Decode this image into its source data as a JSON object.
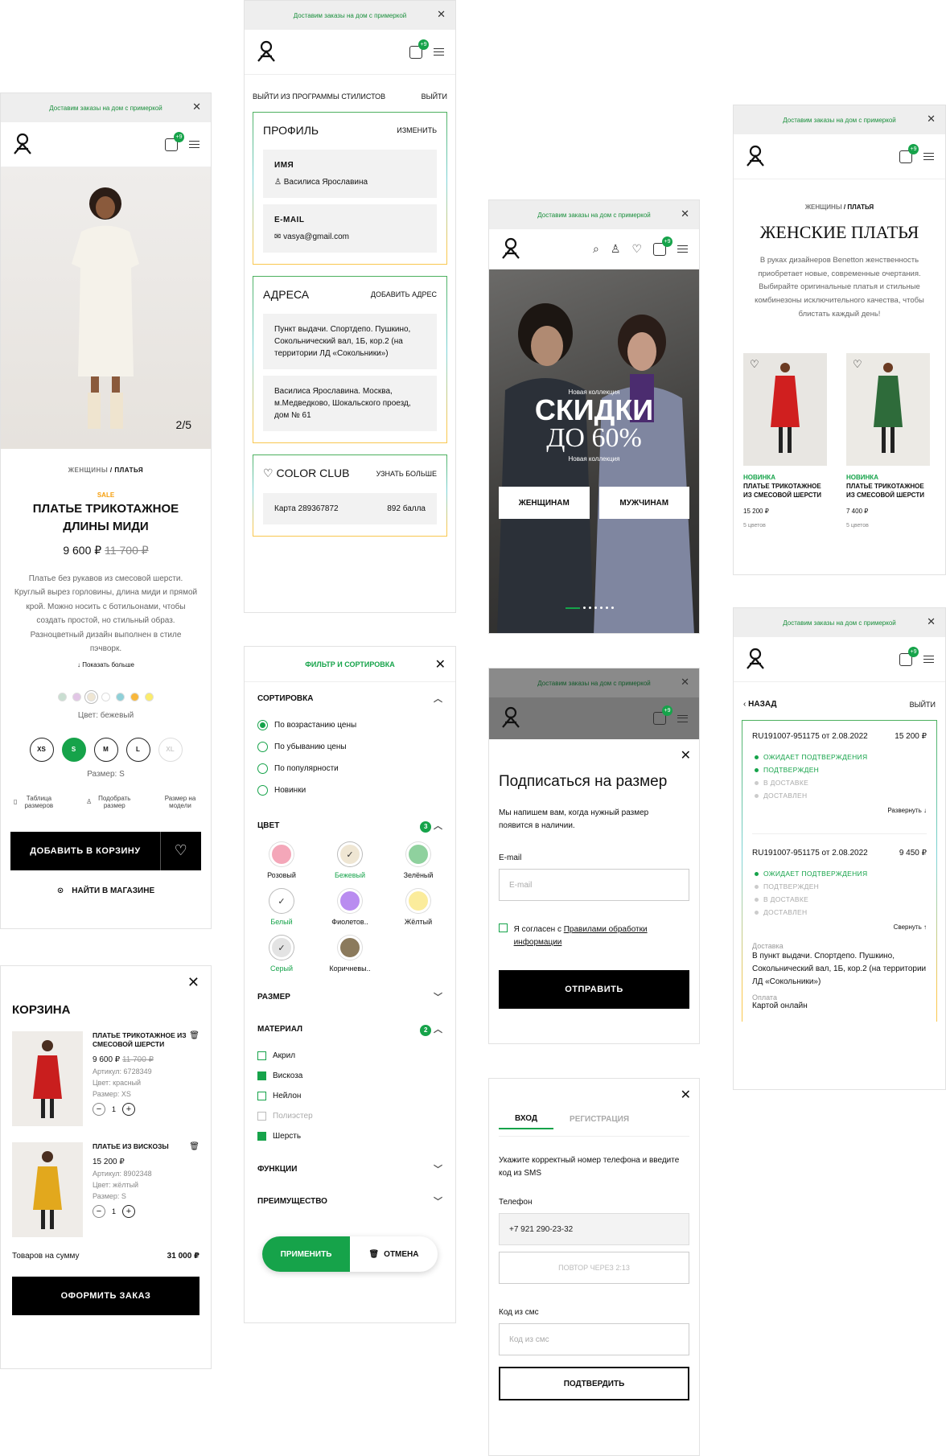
{
  "banner": "Доставим заказы на дом с примеркой",
  "cart_badge": "+9",
  "brand_green": "#16a34a",
  "product": {
    "photo_counter": "2/5",
    "breadcrumb_women": "ЖЕНЩИНЫ",
    "breadcrumb_sep": "/",
    "breadcrumb_dresses": "ПЛАТЬЯ",
    "sale": "SALE",
    "title": "ПЛАТЬЕ ТРИКОТАЖНОЕ ДЛИНЫ МИДИ",
    "price": "9 600 ₽",
    "old_price": "11 700 ₽",
    "description": "Платье без рукавов из смесовой шерсти. Круглый вырез горловины, длина миди и прямой крой. Можно носить с ботильонами, чтобы создать простой, но стильный образ. Разноцветный дизайн выполнен в стиле пэчворк.",
    "show_more": "Показать больше",
    "color_label": "Цвет: бежевый",
    "sizes": [
      "XS",
      "S",
      "M",
      "L",
      "XL"
    ],
    "size_label": "Размер: S",
    "size_table": "Таблица размеров",
    "pick_size": "Подобрать размер",
    "model_size": "Размер на модели",
    "add_to_cart": "ДОБАВИТЬ В КОРЗИНУ",
    "find_in_store": "НАЙТИ В МАГАЗИНЕ"
  },
  "cart": {
    "title": "КОРЗИНА",
    "items": [
      {
        "name": "ПЛАТЬЕ ТРИКОТАЖНОЕ ИЗ СМЕСОВОЙ ШЕРСТИ",
        "price": "9 600 ₽",
        "old_price": "11 700 ₽",
        "article": "Артикул: 6728349",
        "color": "Цвет: красный",
        "size": "Размер: XS",
        "qty": "1"
      },
      {
        "name": "ПЛАТЬЕ ИЗ ВИСКОЗЫ",
        "price": "15 200 ₽",
        "old_price": "",
        "article": "Артикул: 8902348",
        "color": "Цвет: жёлтый",
        "size": "Размер: S",
        "qty": "1"
      }
    ],
    "total_label": "Товаров на сумму",
    "total": "31 000 ₽",
    "checkout": "ОФОРМИТЬ ЗАКАЗ"
  },
  "profile": {
    "exit_program": "ВЫЙТИ ИЗ ПРОГРАММЫ СТИЛИСТОВ",
    "exit": "ВЫЙТИ",
    "profile_title": "ПРОФИЛЬ",
    "edit": "ИЗМЕНИТЬ",
    "name_label": "ИМЯ",
    "name": "Василиса Ярославина",
    "email_label": "E-MAIL",
    "email": "vasya@gmail.com",
    "addresses_title": "АДРЕСА",
    "add_address": "ДОБАВИТЬ АДРЕС",
    "address1": "Пункт выдачи. Спортдепо. Пушкино, Сокольнический вал, 1Б, кор.2 (на территории ЛД «Сокольники»)",
    "address2": "Василиса Ярославина. Москва, м.Медведково, Шокальского проезд, дом № 61",
    "club_title": "COLOR CLUB",
    "learn_more": "УЗНАТЬ БОЛЬШЕ",
    "card": "Карта 289367872",
    "points": "892 балла"
  },
  "filter": {
    "title": "ФИЛЬТР И СОРТИРОВКА",
    "sorting": "СОРТИРОВКА",
    "sort_options": [
      "По возрастанию цены",
      "По убыванию цены",
      "По популярности",
      "Новинки"
    ],
    "color": "ЦВЕТ",
    "color_count": "3",
    "colors": [
      {
        "name": "Розовый",
        "hex": "#f4a7b9"
      },
      {
        "name": "Бежевый",
        "hex": "#efe6d3"
      },
      {
        "name": "Зелёный",
        "hex": "#8fd19e"
      },
      {
        "name": "Белый",
        "hex": "#ffffff"
      },
      {
        "name": "Фиолетов..",
        "hex": "#b98cf0"
      },
      {
        "name": "Жёлтый",
        "hex": "#fbec9c"
      },
      {
        "name": "Серый",
        "hex": "#e3e3e3"
      },
      {
        "name": "Коричневы..",
        "hex": "#8b7a5c"
      }
    ],
    "size": "РАЗМЕР",
    "material": "МАТЕРИАЛ",
    "material_count": "2",
    "materials": [
      "Акрил",
      "Вискоза",
      "Нейлон",
      "Полиэстер",
      "Шерсть"
    ],
    "functions": "ФУНКЦИИ",
    "advantage": "ПРЕИМУЩЕСТВО",
    "apply": "ПРИМЕНИТЬ",
    "cancel": "ОТМЕНА"
  },
  "home": {
    "new_collection": "Новая коллекция",
    "sale_line1": "СКИДКИ",
    "sale_line2": "ДО 60%",
    "women": "ЖЕНЩИНАМ",
    "men": "МУЖЧИНАМ"
  },
  "subscribe": {
    "title": "Подписаться на размер",
    "text": "Мы напишем вам, когда нужный размер появится в наличии.",
    "email_label": "E-mail",
    "email_placeholder": "E-mail",
    "agree_prefix": "Я согласен с ",
    "agree_link": "Правилами обработки информации",
    "send": "ОТПРАВИТЬ"
  },
  "login": {
    "tab_login": "ВХОД",
    "tab_register": "РЕГИСТРАЦИЯ",
    "text": "Укажите корректный номер телефона и введите код из SMS",
    "phone_label": "Телефон",
    "phone": "+7 921 290-23-32",
    "repeat": "ПОВТОР ЧЕРЕЗ 2:13",
    "code_label": "Код из смс",
    "code_placeholder": "Код из смс",
    "confirm": "ПОДТВЕРДИТЬ"
  },
  "category": {
    "breadcrumb_women": "ЖЕНЩИНЫ",
    "breadcrumb_dresses": "ПЛАТЬЯ",
    "title": "ЖЕНСКИЕ ПЛАТЬЯ",
    "text": "В руках дизайнеров Benetton женственность приобретает новые, современные очертания. Выбирайте оригинальные платья и стильные комбинезоны исключительного качества, чтобы блистать каждый день!",
    "products": [
      {
        "badge": "НОВИНКА",
        "name": "ПЛАТЬЕ ТРИКОТАЖНОЕ ИЗ СМЕСОВОЙ ШЕРСТИ",
        "price": "15 200 ₽",
        "colors": "5 цветов"
      },
      {
        "badge": "НОВИНКА",
        "name": "ПЛАТЬЕ ТРИКОТАЖНОЕ ИЗ СМЕСОВОЙ ШЕРСТИ",
        "price": "7 400 ₽",
        "colors": "5 цветов"
      }
    ]
  },
  "orders": {
    "back": "НАЗАД",
    "exit": "ВЫЙТИ",
    "order1": {
      "id": "RU191007-951175 от 2.08.2022",
      "total": "15 200 ₽",
      "statuses": [
        "ОЖИДАЕТ ПОДТВЕРЖДЕНИЯ",
        "ПОДТВЕРЖДЕН",
        "В ДОСТАВКЕ",
        "ДОСТАВЛЕН"
      ],
      "toggle": "Развернуть"
    },
    "order2": {
      "id": "RU191007-951175 от 2.08.2022",
      "total": "9 450 ₽",
      "statuses": [
        "ОЖИДАЕТ ПОДТВЕРЖДЕНИЯ",
        "ПОДТВЕРЖДЕН",
        "В ДОСТАВКЕ",
        "ДОСТАВЛЕН"
      ],
      "toggle": "Свернуть"
    },
    "delivery_label": "Доставка",
    "delivery": "В пункт выдачи. Спортдепо. Пушкино, Сокольнический вал, 1Б, кор.2 (на территории ЛД «Сокольники»)",
    "payment_label": "Оплата",
    "payment": "Картой онлайн"
  }
}
